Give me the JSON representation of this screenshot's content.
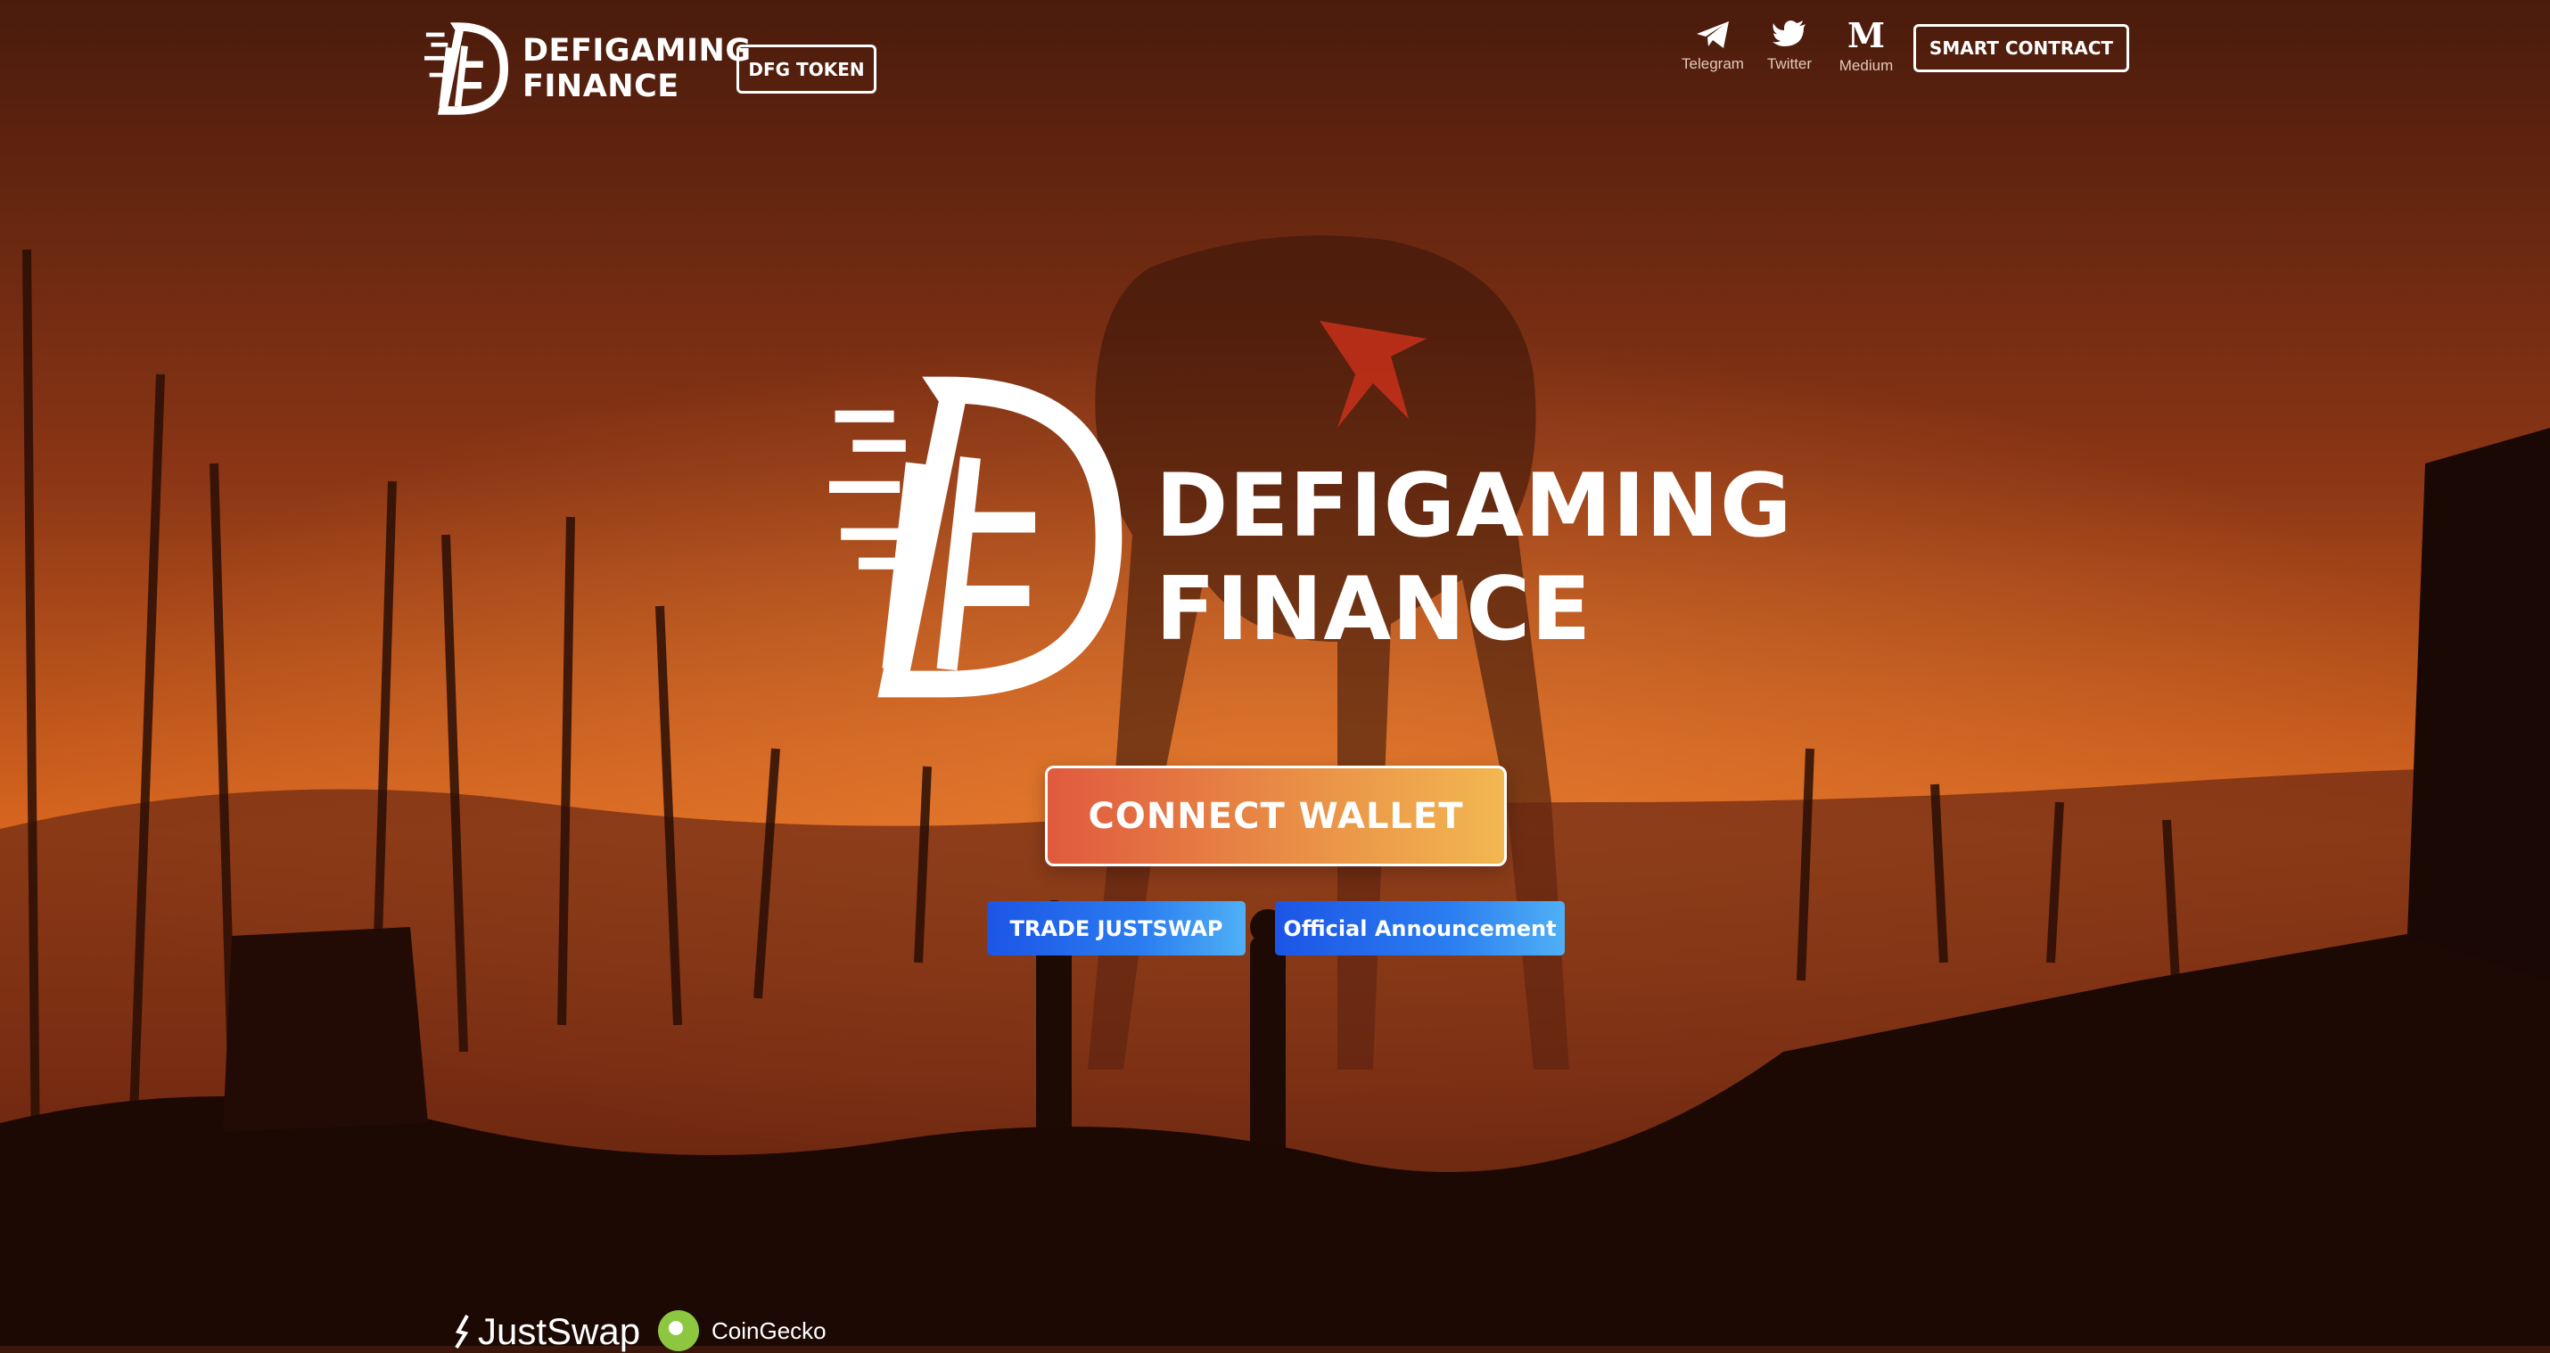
{
  "header": {
    "logo_line1": "DEFIGAMING",
    "logo_line2": "FINANCE",
    "token_button": "DFG TOKEN",
    "social": [
      {
        "label": "Telegram",
        "icon": "telegram-icon"
      },
      {
        "label": "Twitter",
        "icon": "twitter-icon"
      },
      {
        "label": "Medium",
        "icon": "medium-icon",
        "glyph": "M"
      }
    ],
    "contract_button": "SMART CONTRACT"
  },
  "hero": {
    "title_line1": "DEFIGAMING",
    "title_line2": "FINANCE",
    "connect_button": "CONNECT WALLET",
    "trade_button": "TRADE JUSTSWAP",
    "announcement_button": "Official Announcement"
  },
  "partners": [
    {
      "name": "JustSwap"
    },
    {
      "name": "CoinGecko"
    }
  ],
  "colors": {
    "connect_gradient_start": "#e05a3e",
    "connect_gradient_end": "#f2b750",
    "blue_button": "#1c55e6",
    "background": "#b24a1e"
  }
}
